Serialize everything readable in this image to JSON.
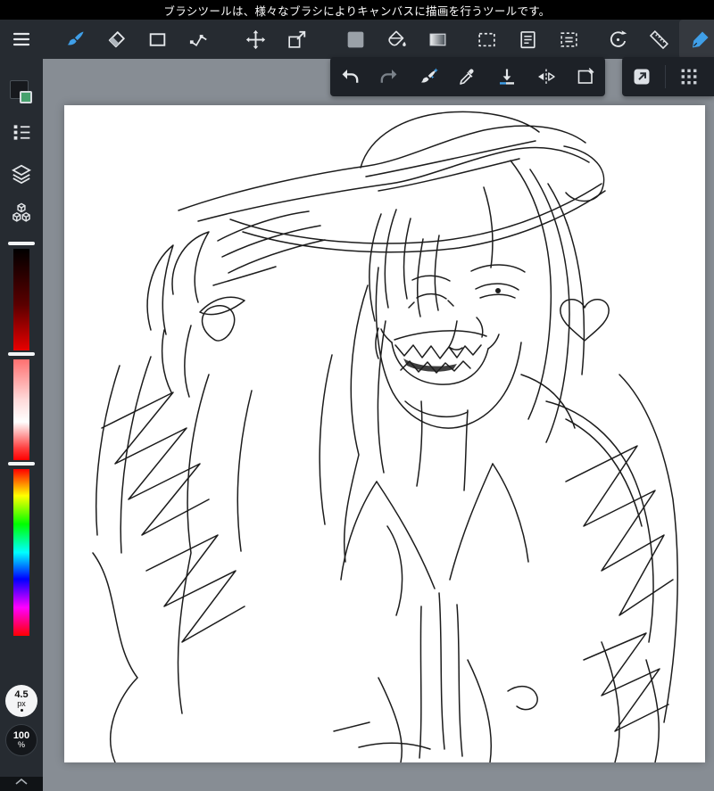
{
  "notification_bar": {
    "text": "ブラシツールは、様々なブラシによりキャンバスに描画を行うツールです。"
  },
  "main_toolbar": {
    "tools": [
      "menu",
      "brush",
      "eraser",
      "rectangle",
      "polyline",
      "move",
      "transform",
      "color-swatch",
      "fill-bucket",
      "gradient",
      "marquee-select",
      "layer-document",
      "select-options",
      "rotate-canvas",
      "ruler",
      "pen"
    ],
    "active_tool": "brush"
  },
  "quick_toolbar": {
    "tools": [
      "undo",
      "redo",
      "brush-effects",
      "eyedropper",
      "save",
      "flip-horizontal",
      "clear-layer"
    ],
    "extra_tools": [
      "open-in-window",
      "drag-handle"
    ]
  },
  "sidebar": {
    "tools": [
      "color-chip",
      "brush-list",
      "layers",
      "materials"
    ],
    "color_sliders": [
      "shade",
      "tint",
      "hue"
    ],
    "brush_size": {
      "value": "4.5",
      "unit": "px"
    },
    "zoom": {
      "value": "100",
      "unit": "%"
    }
  },
  "colors": {
    "accent_blue": "#3f9fe8",
    "topbar_bg": "#000000",
    "toolbar_bg": "#262b31",
    "floating_bg": "#1d2127",
    "canvas_surround": "#878d94",
    "swatch_primary": "#17191d",
    "swatch_secondary": "#47a16e",
    "current_color": "#ff0000",
    "toolbar_gray_swatch": "#9aa1a8"
  }
}
